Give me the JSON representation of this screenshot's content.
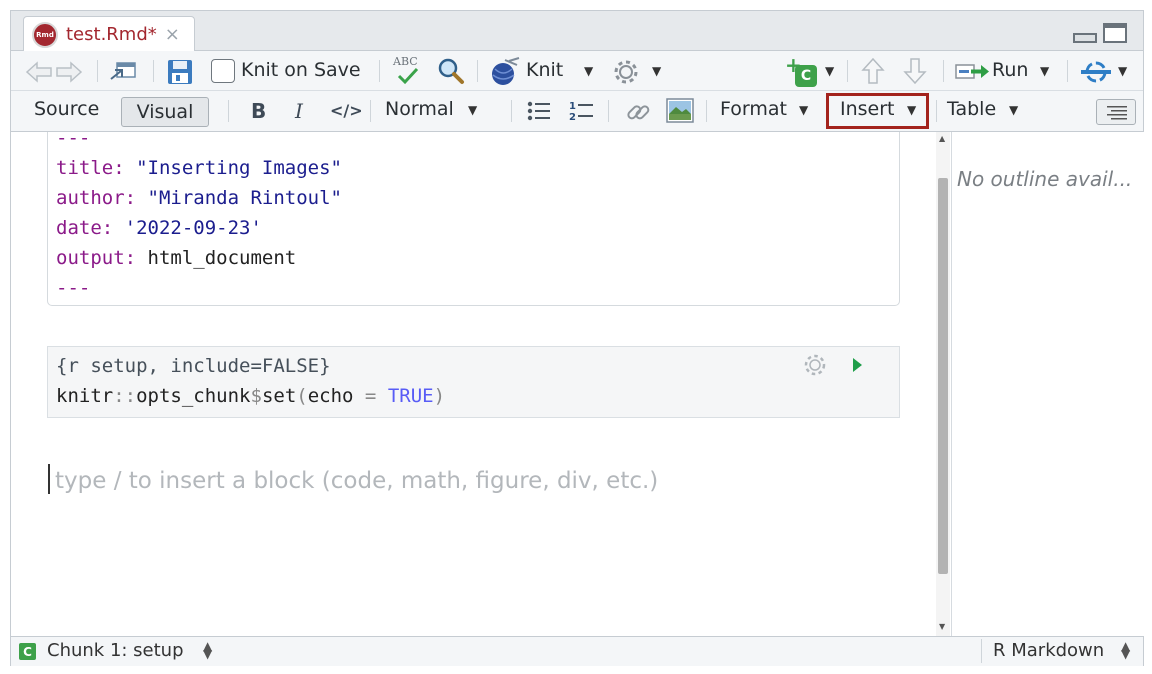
{
  "tab": {
    "icon_text": "Rmd",
    "title": "test.Rmd*",
    "close": "×"
  },
  "toolbar1": {
    "knit_on_save": "Knit on Save",
    "spell_abc": "ABC",
    "knit": "Knit",
    "run": "Run",
    "insert_chunk_badge": "C"
  },
  "toolbar2": {
    "source": "Source",
    "visual": "Visual",
    "bold": "B",
    "italic": "I",
    "code": "</>",
    "style": "Normal",
    "format": "Format",
    "insert": "Insert",
    "table": "Table"
  },
  "yaml": {
    "dashes": "---",
    "title_key": "title:",
    "title_val": "\"Inserting Images\"",
    "author_key": "author:",
    "author_val": "\"Miranda Rintoul\"",
    "date_key": "date:",
    "date_val": "'2022-09-23'",
    "output_key": "output:",
    "output_val": "html_document"
  },
  "chunk": {
    "header": "{r setup, include=FALSE}",
    "line_a": "knitr",
    "line_b": "::",
    "line_c": "opts_chunk",
    "line_d": "$",
    "line_e": "set",
    "line_f": "(echo ",
    "line_g": "=",
    "line_h": " TRUE",
    "line_i": ")"
  },
  "placeholder": "type / to insert a block (code, math, figure, div, etc.)",
  "outline": "No outline avail...",
  "status": {
    "badge": "C",
    "chunk": "Chunk 1: setup",
    "mode": "R Markdown"
  },
  "colors": {
    "accent_red": "#a3272f",
    "highlight": "#a3231d",
    "key": "#8b1a89",
    "string": "#1b1d8e"
  }
}
